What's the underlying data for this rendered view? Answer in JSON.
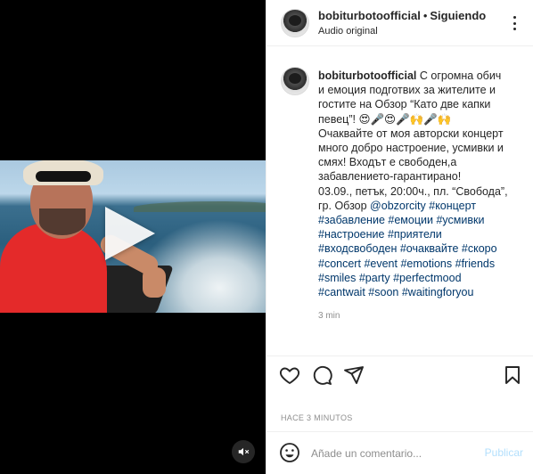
{
  "post": {
    "username": "bobiturbotoofficial",
    "header_separator": "•",
    "follow_status": "Siguiendo",
    "audio_label": "Audio original",
    "caption_lines": [
      [
        {
          "t": "bobiturbotoofficial",
          "k": "user"
        },
        {
          "t": " С огромна обич",
          "k": "text"
        }
      ],
      [
        {
          "t": "и емоция подготвих за жителите и",
          "k": "text"
        }
      ],
      [
        {
          "t": "гостите на Обзор “Като две капки",
          "k": "text"
        }
      ],
      [
        {
          "t": "певец”! 😍🎤😍🎤🙌🎤🙌",
          "k": "text"
        }
      ],
      [
        {
          "t": "Очаквайте от моя авторски концерт",
          "k": "text"
        }
      ],
      [
        {
          "t": "много добро настроение, усмивки и",
          "k": "text"
        }
      ],
      [
        {
          "t": "смях! Входът е свободен,а",
          "k": "text"
        }
      ],
      [
        {
          "t": "забавлението-гарантирано!",
          "k": "text"
        }
      ],
      [
        {
          "t": "03.09., петък, 20:00ч., пл. “Свобода”,",
          "k": "text"
        }
      ],
      [
        {
          "t": "гр. Обзор ",
          "k": "text"
        },
        {
          "t": "@obzorcity",
          "k": "tag"
        },
        {
          "t": " ",
          "k": "text"
        },
        {
          "t": "#концерт",
          "k": "tag"
        }
      ],
      [
        {
          "t": "#забавление",
          "k": "tag"
        },
        {
          "t": " ",
          "k": "text"
        },
        {
          "t": "#емоции",
          "k": "tag"
        },
        {
          "t": " ",
          "k": "text"
        },
        {
          "t": "#усмивки",
          "k": "tag"
        }
      ],
      [
        {
          "t": "#настроение",
          "k": "tag"
        },
        {
          "t": " ",
          "k": "text"
        },
        {
          "t": "#приятели",
          "k": "tag"
        }
      ],
      [
        {
          "t": "#входсвободен",
          "k": "tag"
        },
        {
          "t": " ",
          "k": "text"
        },
        {
          "t": "#очаквайте",
          "k": "tag"
        },
        {
          "t": " ",
          "k": "text"
        },
        {
          "t": "#скоро",
          "k": "tag"
        }
      ],
      [
        {
          "t": "#concert",
          "k": "tag"
        },
        {
          "t": " ",
          "k": "text"
        },
        {
          "t": "#event",
          "k": "tag"
        },
        {
          "t": " ",
          "k": "text"
        },
        {
          "t": "#emotions",
          "k": "tag"
        },
        {
          "t": " ",
          "k": "text"
        },
        {
          "t": "#friends",
          "k": "tag"
        }
      ],
      [
        {
          "t": "#smiles",
          "k": "tag"
        },
        {
          "t": " ",
          "k": "text"
        },
        {
          "t": "#party",
          "k": "tag"
        },
        {
          "t": " ",
          "k": "text"
        },
        {
          "t": "#perfectmood",
          "k": "tag"
        }
      ],
      [
        {
          "t": "#cantwait",
          "k": "tag"
        },
        {
          "t": " ",
          "k": "text"
        },
        {
          "t": "#soon",
          "k": "tag"
        },
        {
          "t": " ",
          "k": "text"
        },
        {
          "t": "#waitingforyou",
          "k": "tag"
        }
      ]
    ],
    "caption_time": "3 min",
    "time_ago": "HACE 3 MINUTOS"
  },
  "comment": {
    "placeholder": "Añade un comentario...",
    "post_label": "Publicar"
  },
  "icons": {
    "like": "heart-icon",
    "comment": "comment-icon",
    "share": "share-icon",
    "save": "bookmark-icon",
    "emoji": "emoji-icon",
    "more": "more-options-icon",
    "mute": "speaker-muted-icon",
    "play": "play-icon"
  },
  "colors": {
    "tag": "#00376b",
    "post_button_disabled": "#b2dffc",
    "media_background": "#000000"
  }
}
